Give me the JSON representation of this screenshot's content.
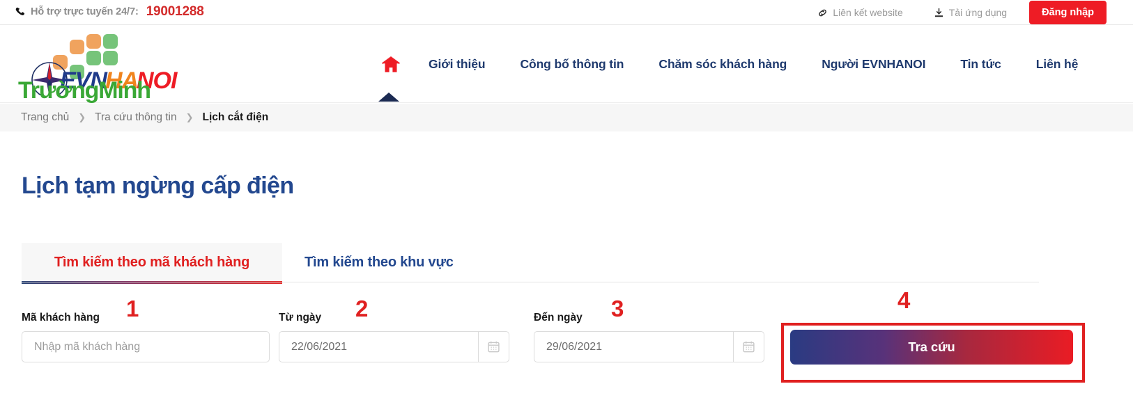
{
  "topbar": {
    "phone_icon": "phone-icon",
    "hotline_label": "Hỗ trợ trực tuyến 24/7:",
    "hotline_number": "19001288",
    "link_website": "Liên kết website",
    "link_website_icon": "link-chain-icon",
    "link_app": "Tải ứng dụng",
    "link_app_icon": "download-icon",
    "login_label": "Đăng nhập",
    "login_bg": "#ee1c25"
  },
  "logo": {
    "brand_evn": "EVN",
    "brand_hanoi": "HANOI",
    "watermark_text": "TrườngMinh",
    "watermark_color": "#3aa836",
    "evn_color": "#1f3a8a",
    "hanoi_color": "#ee1c25"
  },
  "nav": {
    "home_icon": "home-icon",
    "items": [
      {
        "label": "Giới thiệu"
      },
      {
        "label": "Công bố thông tin"
      },
      {
        "label": "Chăm sóc khách hàng"
      },
      {
        "label": "Người EVNHANOI"
      },
      {
        "label": "Tin tức"
      },
      {
        "label": "Liên hệ"
      }
    ],
    "accent_color": "#1f3a6e"
  },
  "breadcrumb": {
    "items": [
      {
        "label": "Trang chủ",
        "current": false
      },
      {
        "label": "Tra cứu thông tin",
        "current": false
      },
      {
        "label": "Lịch cắt điện",
        "current": true
      }
    ],
    "separator": "❯"
  },
  "main": {
    "page_title": "Lịch tạm ngừng cấp điện",
    "title_color": "#23488f",
    "tabs": [
      {
        "label": "Tìm kiếm theo mã khách hàng",
        "active": true
      },
      {
        "label": "Tìm kiếm theo khu vực",
        "active": false
      }
    ],
    "form": {
      "customer_code_label": "Mã khách hàng",
      "customer_code_placeholder": "Nhập mã khách hàng",
      "customer_code_value": "",
      "from_date_label": "Từ ngày",
      "from_date_value": "22/06/2021",
      "to_date_label": "Đến ngày",
      "to_date_value": "29/06/2021",
      "calendar_icon": "calendar-icon",
      "search_button_label": "Tra cứu"
    }
  },
  "annotations": {
    "color": "#e02020",
    "markers": [
      {
        "number": "1",
        "target": "customer-code-field"
      },
      {
        "number": "2",
        "target": "from-date-field"
      },
      {
        "number": "3",
        "target": "to-date-field"
      },
      {
        "number": "4",
        "target": "search-button"
      }
    ]
  }
}
